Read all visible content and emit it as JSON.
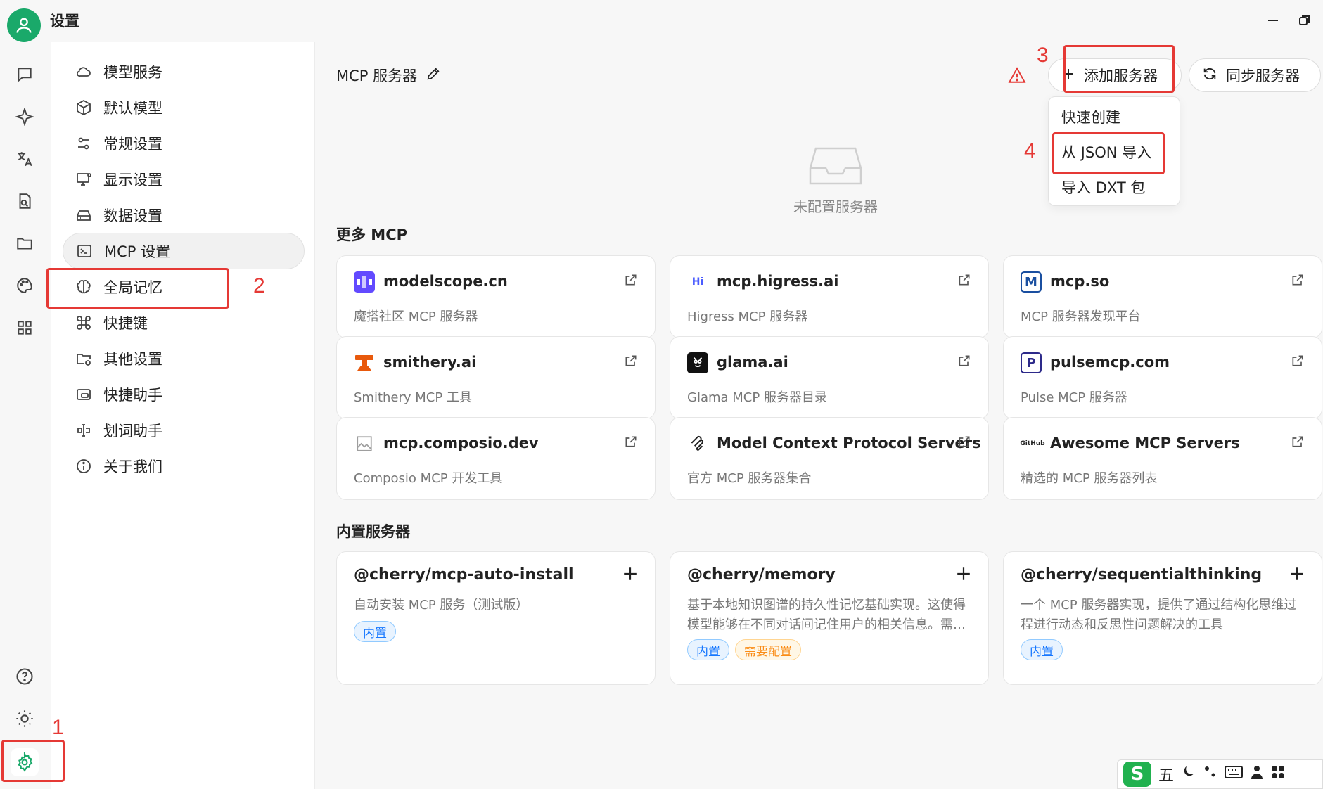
{
  "app": {
    "title": "设置"
  },
  "menu": {
    "items": [
      {
        "id": "model-service",
        "label": "模型服务"
      },
      {
        "id": "default-model",
        "label": "默认模型"
      },
      {
        "id": "general",
        "label": "常规设置"
      },
      {
        "id": "display",
        "label": "显示设置"
      },
      {
        "id": "data",
        "label": "数据设置"
      },
      {
        "id": "mcp",
        "label": "MCP 设置"
      },
      {
        "id": "memory",
        "label": "全局记忆"
      },
      {
        "id": "shortcuts",
        "label": "快捷键"
      },
      {
        "id": "other",
        "label": "其他设置"
      },
      {
        "id": "quick-assistant",
        "label": "快捷助手"
      },
      {
        "id": "selection-assistant",
        "label": "划词助手"
      },
      {
        "id": "about",
        "label": "关于我们"
      }
    ]
  },
  "main": {
    "title": "MCP 服务器",
    "add_button": "添加服务器",
    "sync_button": "同步服务器",
    "dropdown": [
      "快速创建",
      "从 JSON 导入",
      "导入 DXT 包"
    ],
    "empty_text": "未配置服务器",
    "more_title": "更多 MCP",
    "builtin_title": "内置服务器",
    "more_cards": [
      {
        "name": "modelscope.cn",
        "desc": "魔搭社区 MCP 服务器",
        "logo_color": "#624aff"
      },
      {
        "name": "mcp.higress.ai",
        "desc": "Higress MCP 服务器",
        "logo_text": "Hi",
        "logo_color": "#4b5cff"
      },
      {
        "name": "mcp.so",
        "desc": "MCP 服务器发现平台",
        "logo_text": "M",
        "logo_color": "#1a4fa0"
      },
      {
        "name": "smithery.ai",
        "desc": "Smithery MCP 工具",
        "logo_color": "#e8590c"
      },
      {
        "name": "glama.ai",
        "desc": "Glama MCP 服务器目录",
        "logo_color": "#111111"
      },
      {
        "name": "pulsemcp.com",
        "desc": "Pulse MCP 服务器",
        "logo_text": "P",
        "logo_color": "#2d2a8a"
      },
      {
        "name": "mcp.composio.dev",
        "desc": "Composio MCP 开发工具",
        "logo_color": "#9e9e9e"
      },
      {
        "name": "Model Context Protocol Servers",
        "desc": "官方 MCP 服务器集合",
        "logo_color": "#222222"
      },
      {
        "name": "Awesome MCP Servers",
        "desc": "精选的 MCP 服务器列表",
        "logo_text": "GitHub",
        "logo_color": "#222222"
      }
    ],
    "builtin_cards": [
      {
        "name": "@cherry/mcp-auto-install",
        "desc": "自动安装 MCP 服务（测试版）",
        "tags": [
          "内置"
        ]
      },
      {
        "name": "@cherry/memory",
        "desc": "基于本地知识图谱的持久性记忆基础实现。这使得模型能够在不同对话间记住用户的相关信息。需…",
        "tags": [
          "内置",
          "需要配置"
        ]
      },
      {
        "name": "@cherry/sequentialthinking",
        "desc": "一个 MCP 服务器实现，提供了通过结构化思维过程进行动态和反思性问题解决的工具",
        "tags": [
          "内置"
        ]
      }
    ]
  },
  "annotations": {
    "steps": [
      "1",
      "2",
      "3",
      "4"
    ],
    "color": "#e53935"
  },
  "ime": {
    "char": "五",
    "logo": "S"
  }
}
